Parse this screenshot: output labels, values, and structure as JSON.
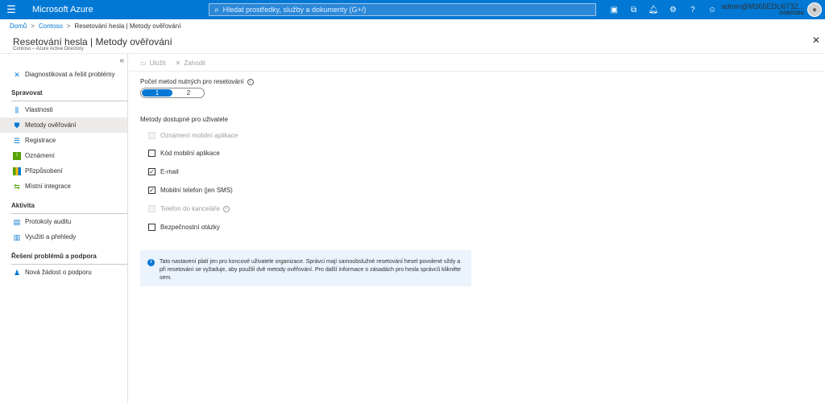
{
  "header": {
    "brand": "Microsoft Azure",
    "search_placeholder": "Hledat prostředky, služby a dokumenty (G+/)",
    "user_name": "admin@M365EDU6732...",
    "tenant": "CONTOSO",
    "icons": [
      "cloud-shell-icon",
      "directory-filter-icon",
      "bell-icon",
      "gear-icon",
      "help-icon",
      "feedback-icon"
    ]
  },
  "breadcrumb": [
    "Domů",
    "Contoso",
    "Resetování hesla | Metody ověřování"
  ],
  "page": {
    "title": "Resetování hesla | Metody ověřování",
    "subtitle": "Contoso – Azure Active Directory"
  },
  "sidebar": {
    "top_item": "Diagnostikovat a řešit problémy",
    "section_manage": "Spravovat",
    "manage_items": [
      "Vlastnosti",
      "Metody ověřování",
      "Registrace",
      "Oznámení",
      "Přizpůsobení",
      "Místní integrace"
    ],
    "section_activity": "Aktivita",
    "activity_items": [
      "Protokoly auditu",
      "Využití a přehledy"
    ],
    "section_support": "Řešení problémů a podpora",
    "support_items": [
      "Nová žádost o podporu"
    ]
  },
  "toolbar": {
    "save": "Uložit",
    "discard": "Zahodit"
  },
  "form": {
    "methods_required_label": "Počet metod nutných pro resetování",
    "options": [
      "1",
      "2"
    ],
    "selected": "1",
    "available_label": "Metody dostupné pro uživatele",
    "methods": [
      {
        "label": "Oznámení mobilní aplikace",
        "checked": false,
        "disabled": true
      },
      {
        "label": "Kód mobilní aplikace",
        "checked": false,
        "disabled": false
      },
      {
        "label": "E-mail",
        "checked": true,
        "disabled": false
      },
      {
        "label": "Mobilní telefon (jen SMS)",
        "checked": true,
        "disabled": false
      },
      {
        "label": "Telefon do kanceláře",
        "checked": false,
        "disabled": true
      },
      {
        "label": "Bezpečnostní otázky",
        "checked": false,
        "disabled": false
      }
    ]
  },
  "info": {
    "text": "Tato nastavení platí jen pro koncové uživatele organizace. Správci mají samoobslužné resetování hesel povolené vždy a při resetování se vyžaduje, aby použili dvě metody ověřování. Pro další informace o zásadách pro hesla správců klikněte sem."
  }
}
